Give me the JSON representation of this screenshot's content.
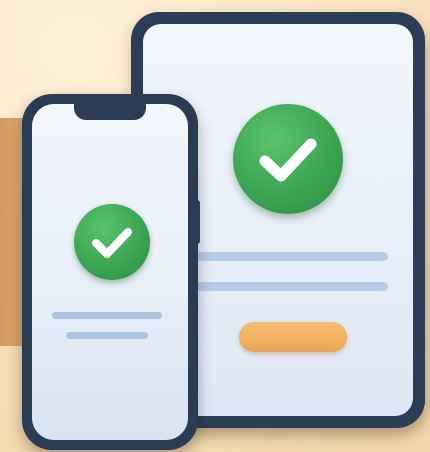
{
  "illustration": {
    "tablet": {
      "check_icon": "check-circle-icon",
      "primary_button_label": "",
      "accent_color": "#3ba552",
      "button_color": "#eaa553"
    },
    "phone": {
      "check_icon": "check-circle-icon",
      "accent_color": "#3ba552"
    },
    "frame_color": "#2c3e57",
    "screen_color": "#eaf1f9",
    "background_color": "#f6ddb6"
  }
}
